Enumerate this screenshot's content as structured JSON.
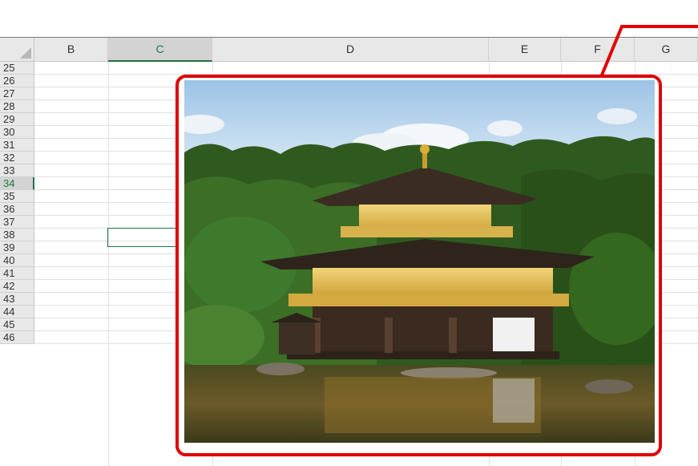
{
  "columns": [
    {
      "letter": "B",
      "selected": false
    },
    {
      "letter": "C",
      "selected": true
    },
    {
      "letter": "D",
      "selected": false
    },
    {
      "letter": "E",
      "selected": false
    },
    {
      "letter": "F",
      "selected": false
    },
    {
      "letter": "G",
      "selected": false
    }
  ],
  "rows": [
    "25",
    "26",
    "27",
    "28",
    "29",
    "30",
    "31",
    "32",
    "33",
    "34",
    "35",
    "36",
    "37",
    "38",
    "39",
    "40",
    "41",
    "42",
    "43",
    "44",
    "45",
    "46"
  ],
  "selected_row": "34",
  "selected_column": "C",
  "colors": {
    "accent": "#217346",
    "callout": "#e00000",
    "header_bg": "#e8e8e8",
    "gridline": "#e1e1e1"
  },
  "image": {
    "subject": "golden pavilion temple by a pond",
    "icon": "picture-icon"
  }
}
